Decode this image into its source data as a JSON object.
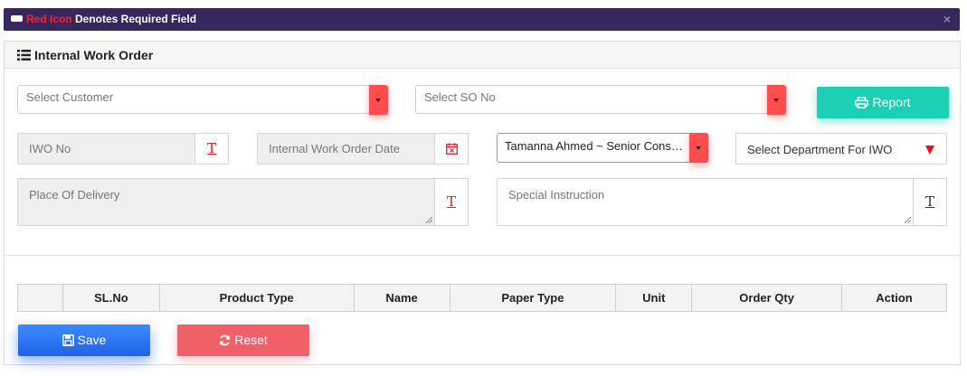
{
  "notice": {
    "highlight": "Red Icon",
    "text": " Denotes Required Field",
    "close": "×"
  },
  "form": {
    "title": "Internal Work Order",
    "customer": {
      "placeholder": "Select Customer"
    },
    "so_no": {
      "placeholder": "Select SO No"
    },
    "report_button": "Report",
    "iwo_no": {
      "placeholder": "IWO No"
    },
    "iwo_date": {
      "placeholder": "Internal Work Order Date"
    },
    "employee": {
      "value": "Tamanna Ahmed ~ Senior Consultant"
    },
    "department": {
      "value": "Select Department For IWO"
    },
    "place_of_delivery": {
      "placeholder": "Place Of Delivery"
    },
    "special_instruction": {
      "placeholder": "Special Instruction"
    },
    "text_icon_glyph": "T"
  },
  "table": {
    "columns": [
      "",
      "SL.No",
      "Product Type",
      "Name",
      "Paper Type",
      "Unit",
      "Order Qty",
      "Action"
    ]
  },
  "buttons": {
    "save": "Save",
    "reset": "Reset"
  },
  "colors": {
    "header_bar": "#37275e",
    "required_red": "#ff4d4f",
    "report": "#1dcfb5",
    "save": "#1e63e9",
    "reset": "#f0616a"
  }
}
